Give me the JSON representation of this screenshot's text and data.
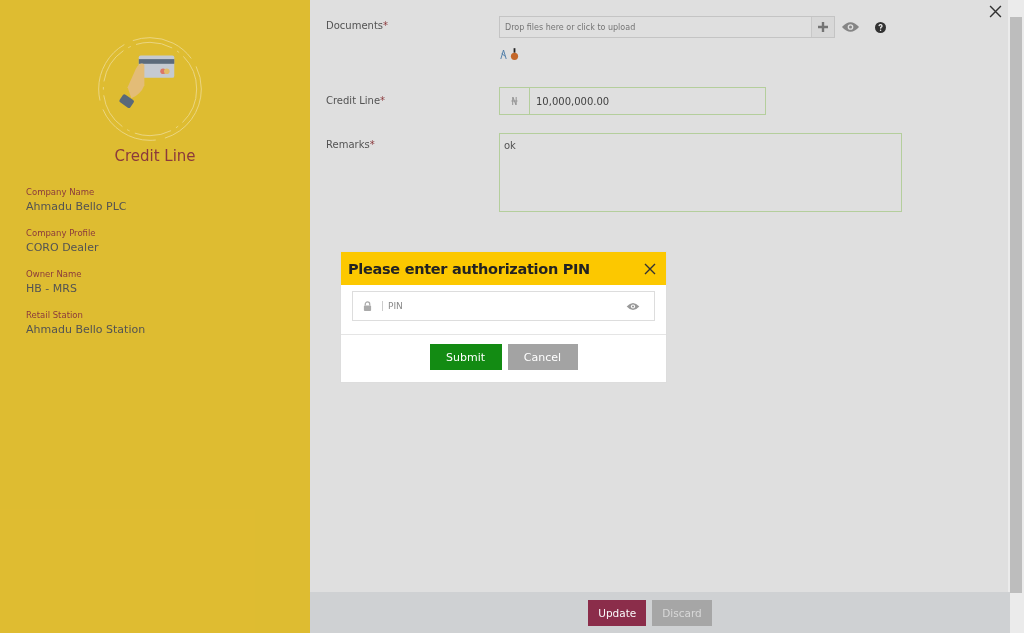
{
  "sidebar": {
    "title": "Credit Line",
    "fields": [
      {
        "label": "Company Name",
        "value": "Ahmadu Bello PLC"
      },
      {
        "label": "Company Profile",
        "value": "CORO Dealer"
      },
      {
        "label": "Owner Name",
        "value": "HB - MRS"
      },
      {
        "label": "Retail Station",
        "value": "Ahmadu Bello Station"
      }
    ]
  },
  "form": {
    "documents": {
      "label": "Documents",
      "required_mark": "*",
      "placeholder": "Drop files here or click to upload"
    },
    "credit_line": {
      "label": "Credit Line",
      "required_mark": "*",
      "currency": "₦",
      "value": "10,000,000.00"
    },
    "remarks": {
      "label": "Remarks",
      "required_mark": "*",
      "value": "ok"
    }
  },
  "dialog": {
    "title": "Please enter authorization PIN",
    "pin_placeholder": "PIN",
    "buttons": [
      {
        "label": "Submit",
        "kind": "primary"
      },
      {
        "label": "Cancel",
        "kind": "secondary"
      }
    ]
  },
  "footer": {
    "buttons": [
      {
        "label": "Update",
        "kind": "primary",
        "disabled": false
      },
      {
        "label": "Discard",
        "kind": "secondary",
        "disabled": true
      }
    ]
  }
}
